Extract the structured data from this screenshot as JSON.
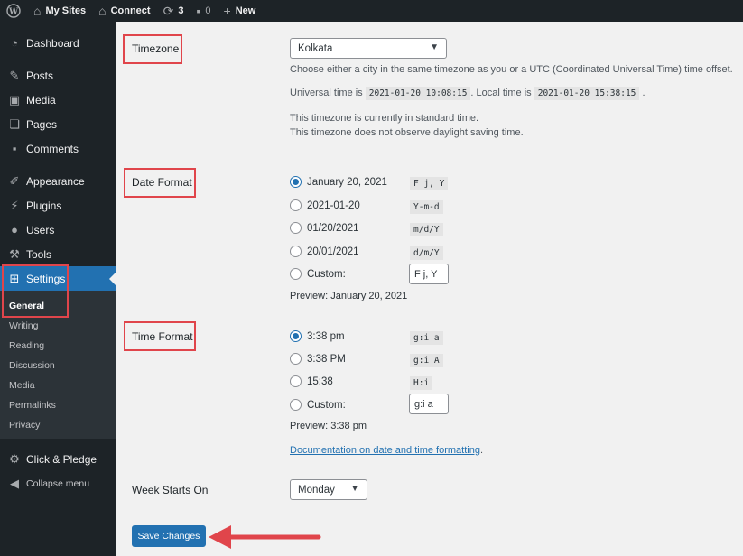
{
  "adminbar": {
    "my_sites": "My Sites",
    "site_name": "Connect",
    "updates": "3",
    "comments": "0",
    "new": "New"
  },
  "sidebar": {
    "items": [
      {
        "label": "Dashboard",
        "icon": "dashboard-icon"
      },
      {
        "label": "Posts",
        "icon": "pin-icon"
      },
      {
        "label": "Media",
        "icon": "media-icon"
      },
      {
        "label": "Pages",
        "icon": "pages-icon"
      },
      {
        "label": "Comments",
        "icon": "comment-icon"
      },
      {
        "label": "Appearance",
        "icon": "brush-icon"
      },
      {
        "label": "Plugins",
        "icon": "plugin-icon"
      },
      {
        "label": "Users",
        "icon": "user-icon"
      },
      {
        "label": "Tools",
        "icon": "wrench-icon"
      },
      {
        "label": "Settings",
        "icon": "settings-icon"
      }
    ],
    "submenu": [
      "General",
      "Writing",
      "Reading",
      "Discussion",
      "Media",
      "Permalinks",
      "Privacy"
    ],
    "extra": {
      "label": "Click & Pledge",
      "icon": "gear-icon"
    },
    "collapse": "Collapse menu"
  },
  "timezone": {
    "label": "Timezone",
    "selected": "Kolkata",
    "help": "Choose either a city in the same timezone as you or a UTC (Coordinated Universal Time) time offset.",
    "universal_label": "Universal time is",
    "universal_value": "2021-01-20 10:08:15",
    "local_label": ". Local time is",
    "local_value": "2021-01-20 15:38:15",
    "end_dot": ".",
    "standard": "This timezone is currently in standard time.",
    "dst": "This timezone does not observe daylight saving time."
  },
  "date_format": {
    "label": "Date Format",
    "options": [
      {
        "label": "January 20, 2021",
        "code": "F j, Y",
        "checked": true
      },
      {
        "label": "2021-01-20",
        "code": "Y-m-d",
        "checked": false
      },
      {
        "label": "01/20/2021",
        "code": "m/d/Y",
        "checked": false
      },
      {
        "label": "20/01/2021",
        "code": "d/m/Y",
        "checked": false
      }
    ],
    "custom_label": "Custom:",
    "custom_value": "F j, Y",
    "preview": "Preview: January 20, 2021"
  },
  "time_format": {
    "label": "Time Format",
    "options": [
      {
        "label": "3:38 pm",
        "code": "g:i a",
        "checked": true
      },
      {
        "label": "3:38 PM",
        "code": "g:i A",
        "checked": false
      },
      {
        "label": "15:38",
        "code": "H:i",
        "checked": false
      }
    ],
    "custom_label": "Custom:",
    "custom_value": "g:i a",
    "preview": "Preview: 3:38 pm",
    "doc_link": "Documentation on date and time formatting",
    "doc_dot": "."
  },
  "week": {
    "label": "Week Starts On",
    "selected": "Monday"
  },
  "save_label": "Save Changes",
  "colors": {
    "accent": "#2271b1",
    "highlight": "#e0454b",
    "sidebar": "#1d2327"
  }
}
